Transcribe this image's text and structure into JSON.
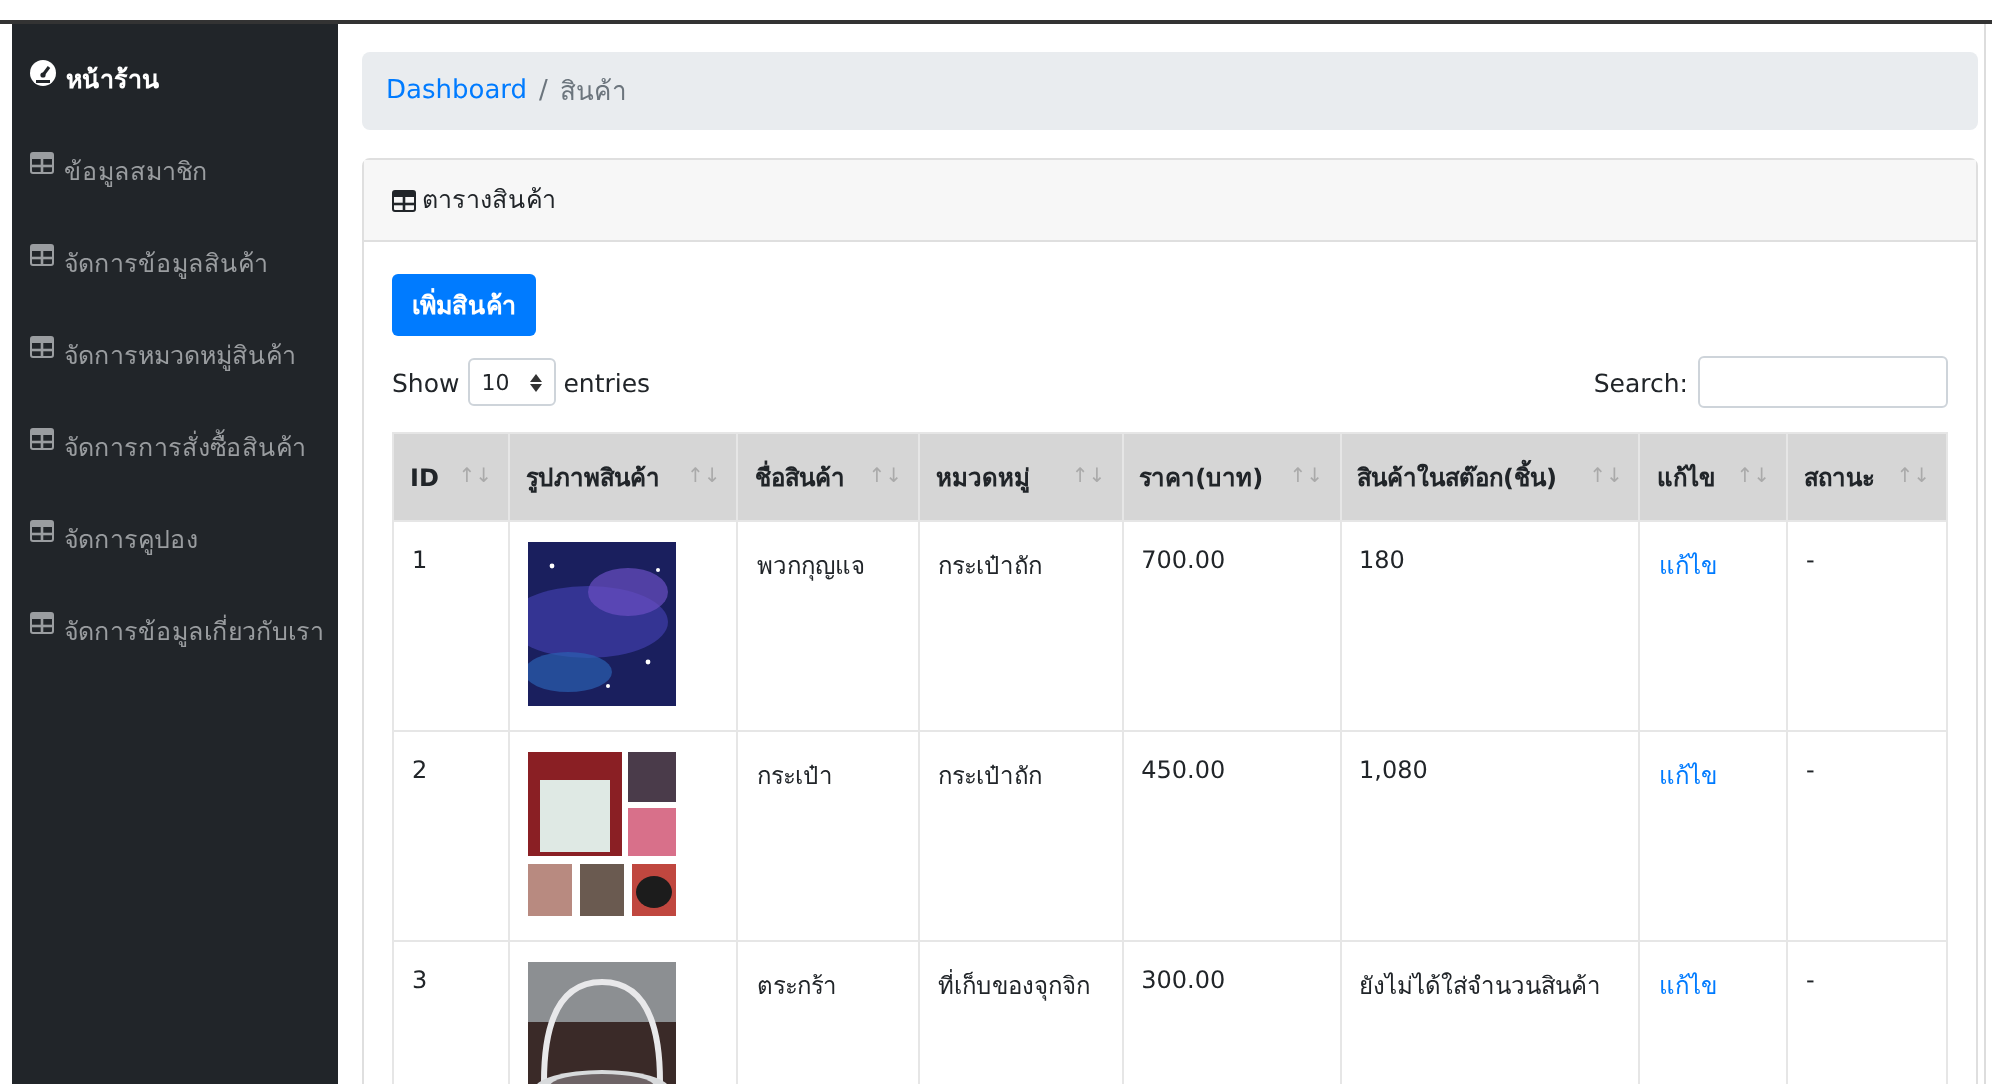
{
  "sidebar": {
    "items": [
      {
        "label": "หน้าร้าน",
        "kind": "dashboard",
        "selected": true
      },
      {
        "label": "ข้อมูลสมาชิก",
        "kind": "table",
        "selected": false
      },
      {
        "label": "จัดการข้อมูลสินค้า",
        "kind": "table",
        "selected": false
      },
      {
        "label": "จัดการหมวดหมู่สินค้า",
        "kind": "table",
        "selected": false
      },
      {
        "label": "จัดการการสั่งซื้อสินค้า",
        "kind": "table",
        "selected": false
      },
      {
        "label": "จัดการคูปอง",
        "kind": "table",
        "selected": false
      },
      {
        "label": "จัดการข้อมูลเกี่ยวกับเรา",
        "kind": "table",
        "selected": false
      }
    ]
  },
  "breadcrumb": {
    "link": "Dashboard",
    "separator": "/",
    "current": "สินค้า"
  },
  "card": {
    "title": "ตารางสินค้า",
    "add_button": "เพิ่มสินค้า",
    "length": {
      "before": "Show",
      "value": "10",
      "after": "entries"
    },
    "search": {
      "label": "Search:"
    },
    "table": {
      "columns": [
        "ID",
        "รูปภาพสินค้า",
        "ชื่อสินค้า",
        "หมวดหมู่",
        "ราคา(บาท)",
        "สินค้าในสต๊อก(ชิ้น)",
        "แก้ไข",
        "สถานะ"
      ],
      "sort_glyph": "↑↓",
      "rows": [
        {
          "id": "1",
          "name": "พวกกุญแจ",
          "category": "กระเป๋าถัก",
          "price": "700.00",
          "stock": "180",
          "edit": "แก้ไข",
          "status": "-"
        },
        {
          "id": "2",
          "name": "กระเป๋า",
          "category": "กระเป๋าถัก",
          "price": "450.00",
          "stock": "1,080",
          "edit": "แก้ไข",
          "status": "-"
        },
        {
          "id": "3",
          "name": "ตระกร้า",
          "category": "ที่เก็บของจุกจิก",
          "price": "300.00",
          "stock": "ยังไม่ได้ใส่จำนวนสินค้า",
          "edit": "แก้ไข",
          "status": "-"
        }
      ]
    }
  }
}
